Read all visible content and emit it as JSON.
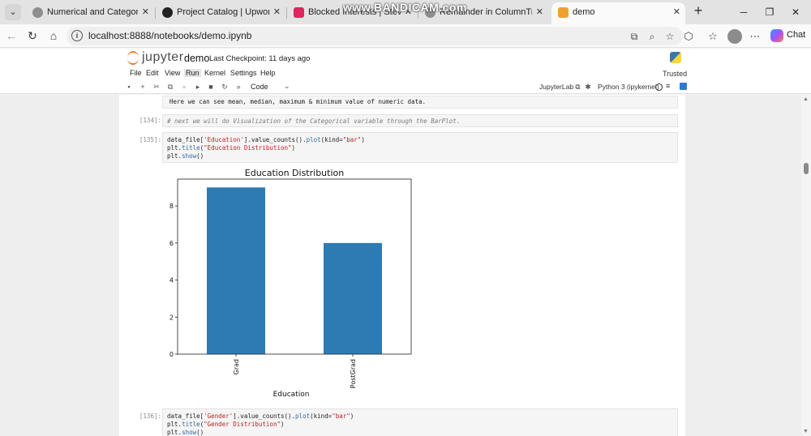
{
  "browser": {
    "tabs": [
      {
        "title": "Numerical and Categorical Feat",
        "favicon_color": "#8e8e8e",
        "active": false
      },
      {
        "title": "Project Catalog | Upwork",
        "favicon_color": "#222222",
        "active": false
      },
      {
        "title": "Blocked Interests | Steven Sum",
        "favicon_color": "#e0245e",
        "active": false
      },
      {
        "title": "Remainder in ColumnTransform",
        "favicon_color": "#8e8e8e",
        "active": false
      },
      {
        "title": "demo",
        "favicon_color": "#f0a030",
        "active": true
      }
    ],
    "tab_close_glyph": "✕",
    "new_tab_glyph": "+",
    "watermark": "www.BANDICAM.com",
    "url": "localhost:8888/notebooks/demo.ipynb",
    "chat_label": "Chat"
  },
  "jupyter": {
    "wordmark": "jupyter",
    "notebook_name": "demo",
    "checkpoint": "Last Checkpoint: 11 days ago",
    "menu": [
      "File",
      "Edit",
      "View",
      "Run",
      "Kernel",
      "Settings",
      "Help"
    ],
    "active_menu": "Run",
    "trusted": "Trusted",
    "cell_type": "Code",
    "jupyterlab_link": "JupyterLab",
    "kernel": "Python 3 (ipykernel)"
  },
  "cells": {
    "markdown_text": "Here we can see mean, median, maximum & minimum value of numeric data.",
    "cell_134": {
      "prompt": "[134]:",
      "line1": "# next we will do Visualization of the Categorical variable through the BarPlot."
    },
    "cell_135": {
      "prompt": "[135]:",
      "l1_a": "data_file[",
      "l1_b": "'Education'",
      "l1_c": "].value_counts().",
      "l1_d": "plot",
      "l1_e": "(kind=",
      "l1_f": "\"bar\"",
      "l1_g": ")",
      "l2_a": "plt.",
      "l2_b": "title",
      "l2_c": "(",
      "l2_d": "\"Education Distribution\"",
      "l2_e": ")",
      "l3_a": "plt.",
      "l3_b": "show",
      "l3_c": "()"
    },
    "cell_136": {
      "prompt": "[136]:",
      "l1_a": "data_file[",
      "l1_b": "'Gender'",
      "l1_c": "].value_counts().",
      "l1_d": "plot",
      "l1_e": "(kind=",
      "l1_f": "\"bar\"",
      "l1_g": ")",
      "l2_a": "plt.",
      "l2_b": "title",
      "l2_c": "(",
      "l2_d": "\"Gender Distribution\"",
      "l2_e": ")",
      "l3_a": "plt.",
      "l3_b": "show",
      "l3_c": "()"
    }
  },
  "chart_data": {
    "type": "bar",
    "title": "Education Distribution",
    "categories": [
      "Grad",
      "PostGrad"
    ],
    "values": [
      9,
      6
    ],
    "xlabel": "Education",
    "ylabel": "",
    "ylim": [
      0,
      9.45
    ],
    "yticks": [
      0,
      2,
      4,
      6,
      8
    ],
    "color": "#2e7bb4",
    "grid": false
  },
  "colors": {
    "jupyter_orange": "#f37726",
    "kernel_blue": "#2f7bd1"
  }
}
